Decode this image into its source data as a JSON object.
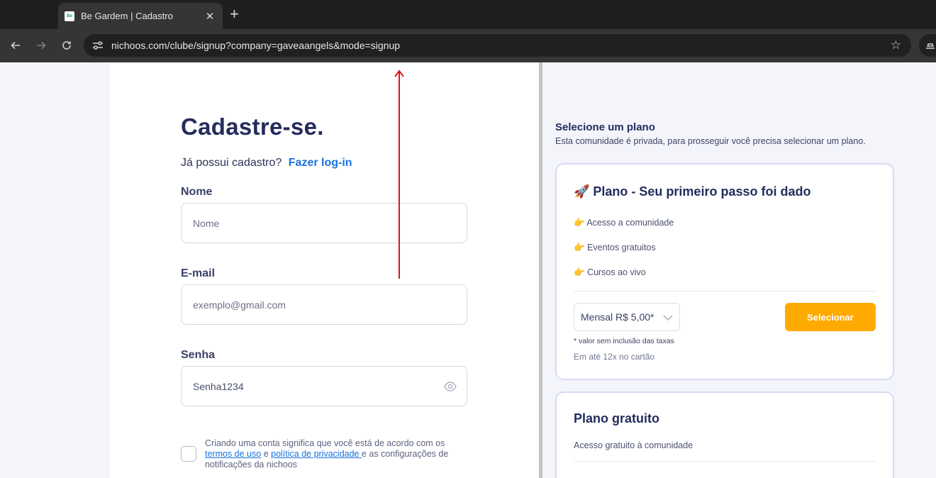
{
  "browser": {
    "tab_title": "Be Gardem | Cadastro",
    "favicon_text": "Be",
    "tab_close": "✕",
    "new_tab": "+",
    "url": "nichoos.com/clube/signup?company=gaveaangels&mode=signup"
  },
  "signup": {
    "title": "Cadastre-se.",
    "login_prompt": "Já possui cadastro?",
    "login_link": "Fazer log-in",
    "fields": {
      "name": {
        "label": "Nome",
        "placeholder": "Nome",
        "value": ""
      },
      "email": {
        "label": "E-mail",
        "placeholder": "exemplo@gmail.com",
        "value": ""
      },
      "password": {
        "label": "Senha",
        "placeholder": "",
        "value": "Senha1234"
      }
    },
    "terms": {
      "text_1": "Criando uma conta significa que você está de acordo com os ",
      "link_1": "termos de uso",
      "text_2": " e ",
      "link_2": "política de privacidade ",
      "text_3": "e as configurações de notificações da nichoos"
    }
  },
  "plans": {
    "section_title": "Selecione um plano",
    "section_subtitle": "Esta comunidade é privada, para prosseguir você precisa selecionar um plano.",
    "paid": {
      "title": "🚀 Plano - Seu primeiro passo foi dado",
      "features": [
        "👉 Acesso a comunidade",
        "👉 Eventos gratuitos",
        "👉 Cursos ao vivo"
      ],
      "price_option": "Mensal R$ 5,00*",
      "select_label": "Selecionar",
      "tax_note": "* valor sem inclusão das taxas",
      "installments": "Em até 12x no cartão"
    },
    "free": {
      "title": "Plano gratuito",
      "description": "Acesso gratuito à comunidade"
    }
  },
  "colors": {
    "accent_orange": "#ffaa00",
    "link_blue": "#1a72de",
    "heading_navy": "#242c5c",
    "annotation_red": "#d9141e"
  }
}
